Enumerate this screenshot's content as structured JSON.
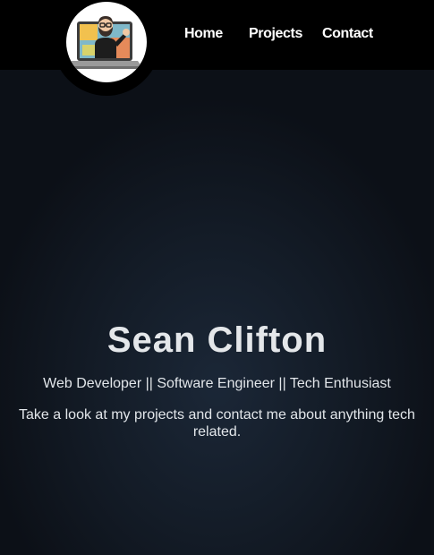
{
  "header": {
    "logo": {
      "icon": "bitmoji-laptop-avatar-icon"
    },
    "nav": {
      "home_label": "Home",
      "projects_label": "Projects",
      "contact_label": "Contact"
    }
  },
  "hero": {
    "name": "Sean Clifton",
    "tagline": "Web Developer || Software Engineer || Tech Enthusiast",
    "blurb": "Take a look at my projects and contact me about anything tech related."
  },
  "colors": {
    "navbar_background": "#000000",
    "page_background_center": "#1b2737",
    "page_background_edge": "#0c1017",
    "text": "#e2e6ea",
    "nav_text": "#ffffff"
  }
}
